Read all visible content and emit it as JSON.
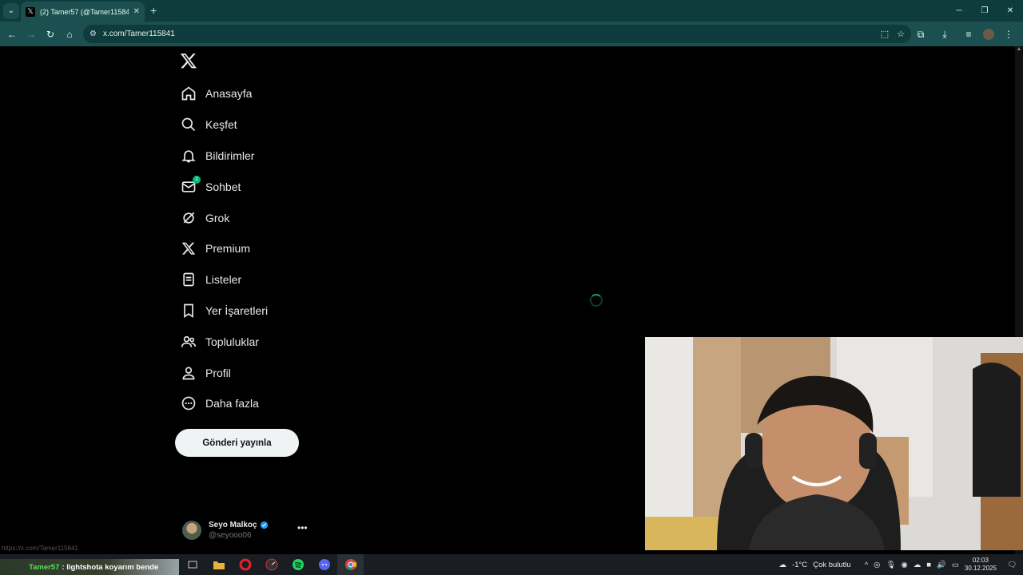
{
  "browser": {
    "tab_title": "(2) Tamer57 (@Tamer115841) /",
    "url": "x.com/Tamer115841"
  },
  "nav": {
    "items": [
      {
        "label": "Anasayfa",
        "icon": "home-icon"
      },
      {
        "label": "Keşfet",
        "icon": "search-icon"
      },
      {
        "label": "Bildirimler",
        "icon": "bell-icon"
      },
      {
        "label": "Sohbet",
        "icon": "mail-icon",
        "badge": "2"
      },
      {
        "label": "Grok",
        "icon": "grok-icon"
      },
      {
        "label": "Premium",
        "icon": "x-logo-icon"
      },
      {
        "label": "Listeler",
        "icon": "list-icon"
      },
      {
        "label": "Yer İşaretleri",
        "icon": "bookmark-icon"
      },
      {
        "label": "Topluluklar",
        "icon": "people-icon"
      },
      {
        "label": "Profil",
        "icon": "person-icon"
      },
      {
        "label": "Daha fazla",
        "icon": "more-circle-icon"
      }
    ],
    "post_button": "Gönderi yayınla"
  },
  "account": {
    "name": "Seyo Malkoç",
    "handle": "@seyooo06"
  },
  "status_url": "https://x.com/Tamer115841",
  "chat_overlay": {
    "user": "Tamer57",
    "message": ": lightshota koyarım bende"
  },
  "taskbar": {
    "weather": "-1°C",
    "weather_desc": "Çok bulutlu",
    "time": "02:03",
    "date": "30.12.2025",
    "notifications": "1"
  },
  "colors": {
    "chrome_frame": "#0e3b3b",
    "chrome_toolbar": "#1c4f4f",
    "page_bg": "#000000",
    "post_button_bg": "#eff3f4",
    "badge": "#00ba7c"
  }
}
